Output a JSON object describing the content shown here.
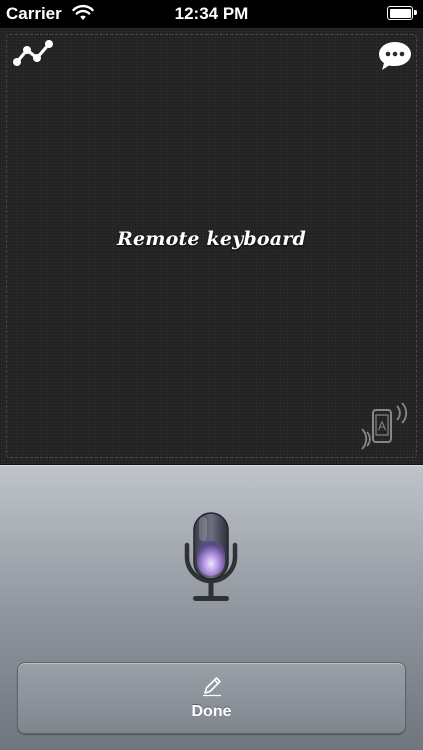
{
  "status_bar": {
    "carrier": "Carrier",
    "time": "12:34 PM",
    "wifi_icon": "wifi-icon",
    "battery_icon": "battery-icon",
    "battery_level": 1.0
  },
  "pad": {
    "title": "Remote keyboard",
    "logo_icon": "graph-icon",
    "chat_icon": "chat-bubble-icon",
    "device_icon": "device-vibrate-icon"
  },
  "mic_panel": {
    "mic_icon": "microphone-icon",
    "done_button": {
      "label": "Done",
      "icon": "pencil-icon"
    }
  },
  "colors": {
    "pad_background": "#252525",
    "panel_top": "#bfc4cb",
    "panel_bottom": "#70767e",
    "mic_glow": "#b79ae6"
  }
}
